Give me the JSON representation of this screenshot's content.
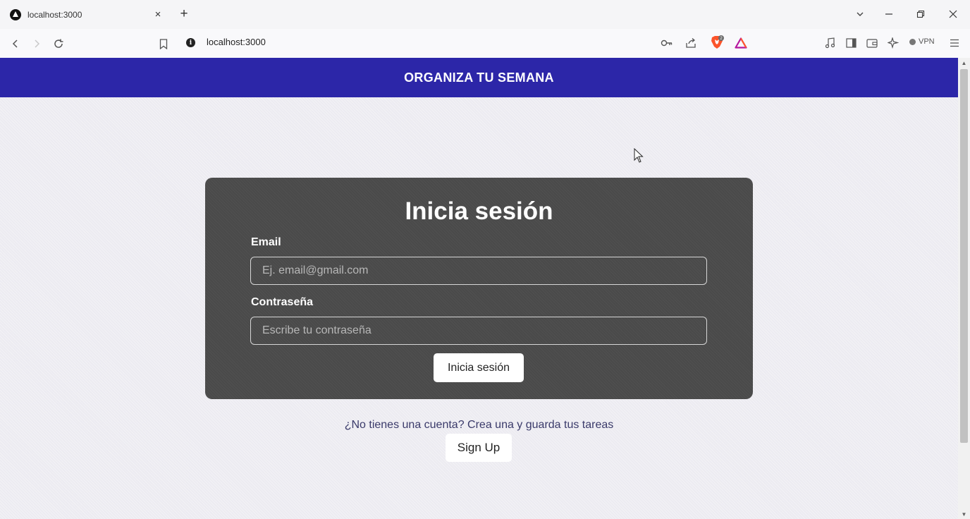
{
  "browser": {
    "tab_title": "localhost:3000",
    "tab_close": "×",
    "new_tab": "+",
    "url": "localhost:3000",
    "vpn_label": "VPN",
    "brave_badge_count": "2",
    "window_controls": [
      "chevron-down",
      "minimize",
      "restore",
      "close"
    ]
  },
  "app": {
    "header_title": "ORGANIZA TU SEMANA",
    "header_color": "#2c26a8"
  },
  "login": {
    "title": "Inicia sesión",
    "email_label": "Email",
    "email_placeholder": "Ej. email@gmail.com",
    "email_value": "",
    "password_label": "Contraseña",
    "password_placeholder": "Escribe tu contraseña",
    "password_value": "",
    "submit_label": "Inicia sesión"
  },
  "signup": {
    "prompt": "¿No tienes una cuenta? Crea una y guarda tus tareas",
    "button_label": "Sign Up"
  }
}
